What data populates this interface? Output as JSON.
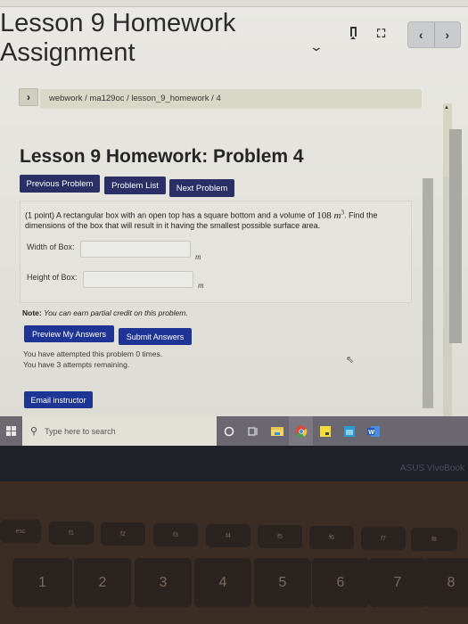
{
  "header": {
    "assignment_title_line1": "Lesson 9 Homework",
    "assignment_title_line2": "Assignment",
    "icons": [
      "chevron-down-icon",
      "bookmark-icon",
      "fullscreen-icon",
      "chevron-left-icon",
      "chevron-right-icon"
    ],
    "prev_glyph": "‹",
    "next_glyph": "›"
  },
  "breadcrumb": {
    "toggle_glyph": "›",
    "path": "webwork / ma129oc / lesson_9_homework / 4"
  },
  "problem": {
    "title": "Lesson 9 Homework: Problem 4",
    "nav_buttons": {
      "previous": "Previous Problem",
      "list": "Problem List",
      "next": "Next Problem"
    },
    "points": "(1 point)",
    "text_before_math": "A rectangular box with an open top has a square bottom and a volume of",
    "math_value": "108",
    "math_unit": "m",
    "math_exponent": "3",
    "text_after_math": ". Find the dimensions of the box that will result in it having the smallest possible surface area.",
    "fields": [
      {
        "label": "Width of Box:",
        "value": "",
        "unit": "m"
      },
      {
        "label": "Height of Box:",
        "value": "",
        "unit": "m"
      }
    ]
  },
  "note": {
    "label": "Note:",
    "text": "You can earn partial credit on this problem."
  },
  "actions": {
    "preview": "Preview My Answers",
    "submit": "Submit Answers",
    "email": "Email instructor"
  },
  "attempts": {
    "line1": "You have attempted this problem 0 times.",
    "line2": "You have 3 attempts remaining."
  },
  "taskbar": {
    "search_placeholder": "Type here to search",
    "apps": [
      "cortana-icon",
      "task-view-icon",
      "file-explorer-icon",
      "chrome-icon",
      "sticky-notes-icon",
      "calendar-icon",
      "word-icon"
    ]
  },
  "device": {
    "brand": "ASUS VivoBook",
    "fkeys": [
      "esc",
      "f1",
      "f2",
      "f3",
      "f4",
      "f5",
      "f6",
      "f7",
      "f8"
    ],
    "numkeys": [
      "1",
      "2",
      "3",
      "4",
      "5",
      "6",
      "7",
      "8"
    ]
  }
}
